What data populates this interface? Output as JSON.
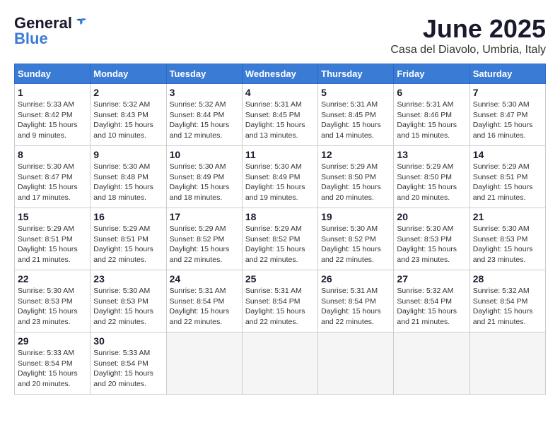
{
  "header": {
    "logo_general": "General",
    "logo_blue": "Blue",
    "month_title": "June 2025",
    "location": "Casa del Diavolo, Umbria, Italy"
  },
  "calendar": {
    "days_of_week": [
      "Sunday",
      "Monday",
      "Tuesday",
      "Wednesday",
      "Thursday",
      "Friday",
      "Saturday"
    ],
    "weeks": [
      [
        null,
        {
          "day": "2",
          "sunrise": "Sunrise: 5:32 AM",
          "sunset": "Sunset: 8:43 PM",
          "daylight": "Daylight: 15 hours and 10 minutes."
        },
        {
          "day": "3",
          "sunrise": "Sunrise: 5:32 AM",
          "sunset": "Sunset: 8:44 PM",
          "daylight": "Daylight: 15 hours and 12 minutes."
        },
        {
          "day": "4",
          "sunrise": "Sunrise: 5:31 AM",
          "sunset": "Sunset: 8:45 PM",
          "daylight": "Daylight: 15 hours and 13 minutes."
        },
        {
          "day": "5",
          "sunrise": "Sunrise: 5:31 AM",
          "sunset": "Sunset: 8:45 PM",
          "daylight": "Daylight: 15 hours and 14 minutes."
        },
        {
          "day": "6",
          "sunrise": "Sunrise: 5:31 AM",
          "sunset": "Sunset: 8:46 PM",
          "daylight": "Daylight: 15 hours and 15 minutes."
        },
        {
          "day": "7",
          "sunrise": "Sunrise: 5:30 AM",
          "sunset": "Sunset: 8:47 PM",
          "daylight": "Daylight: 15 hours and 16 minutes."
        }
      ],
      [
        {
          "day": "1",
          "sunrise": "Sunrise: 5:33 AM",
          "sunset": "Sunset: 8:42 PM",
          "daylight": "Daylight: 15 hours and 9 minutes."
        },
        {
          "day": "9",
          "sunrise": "Sunrise: 5:30 AM",
          "sunset": "Sunset: 8:48 PM",
          "daylight": "Daylight: 15 hours and 18 minutes."
        },
        {
          "day": "10",
          "sunrise": "Sunrise: 5:30 AM",
          "sunset": "Sunset: 8:49 PM",
          "daylight": "Daylight: 15 hours and 18 minutes."
        },
        {
          "day": "11",
          "sunrise": "Sunrise: 5:30 AM",
          "sunset": "Sunset: 8:49 PM",
          "daylight": "Daylight: 15 hours and 19 minutes."
        },
        {
          "day": "12",
          "sunrise": "Sunrise: 5:29 AM",
          "sunset": "Sunset: 8:50 PM",
          "daylight": "Daylight: 15 hours and 20 minutes."
        },
        {
          "day": "13",
          "sunrise": "Sunrise: 5:29 AM",
          "sunset": "Sunset: 8:50 PM",
          "daylight": "Daylight: 15 hours and 20 minutes."
        },
        {
          "day": "14",
          "sunrise": "Sunrise: 5:29 AM",
          "sunset": "Sunset: 8:51 PM",
          "daylight": "Daylight: 15 hours and 21 minutes."
        }
      ],
      [
        {
          "day": "8",
          "sunrise": "Sunrise: 5:30 AM",
          "sunset": "Sunset: 8:47 PM",
          "daylight": "Daylight: 15 hours and 17 minutes."
        },
        {
          "day": "16",
          "sunrise": "Sunrise: 5:29 AM",
          "sunset": "Sunset: 8:51 PM",
          "daylight": "Daylight: 15 hours and 22 minutes."
        },
        {
          "day": "17",
          "sunrise": "Sunrise: 5:29 AM",
          "sunset": "Sunset: 8:52 PM",
          "daylight": "Daylight: 15 hours and 22 minutes."
        },
        {
          "day": "18",
          "sunrise": "Sunrise: 5:29 AM",
          "sunset": "Sunset: 8:52 PM",
          "daylight": "Daylight: 15 hours and 22 minutes."
        },
        {
          "day": "19",
          "sunrise": "Sunrise: 5:30 AM",
          "sunset": "Sunset: 8:52 PM",
          "daylight": "Daylight: 15 hours and 22 minutes."
        },
        {
          "day": "20",
          "sunrise": "Sunrise: 5:30 AM",
          "sunset": "Sunset: 8:53 PM",
          "daylight": "Daylight: 15 hours and 23 minutes."
        },
        {
          "day": "21",
          "sunrise": "Sunrise: 5:30 AM",
          "sunset": "Sunset: 8:53 PM",
          "daylight": "Daylight: 15 hours and 23 minutes."
        }
      ],
      [
        {
          "day": "15",
          "sunrise": "Sunrise: 5:29 AM",
          "sunset": "Sunset: 8:51 PM",
          "daylight": "Daylight: 15 hours and 21 minutes."
        },
        {
          "day": "23",
          "sunrise": "Sunrise: 5:30 AM",
          "sunset": "Sunset: 8:53 PM",
          "daylight": "Daylight: 15 hours and 22 minutes."
        },
        {
          "day": "24",
          "sunrise": "Sunrise: 5:31 AM",
          "sunset": "Sunset: 8:54 PM",
          "daylight": "Daylight: 15 hours and 22 minutes."
        },
        {
          "day": "25",
          "sunrise": "Sunrise: 5:31 AM",
          "sunset": "Sunset: 8:54 PM",
          "daylight": "Daylight: 15 hours and 22 minutes."
        },
        {
          "day": "26",
          "sunrise": "Sunrise: 5:31 AM",
          "sunset": "Sunset: 8:54 PM",
          "daylight": "Daylight: 15 hours and 22 minutes."
        },
        {
          "day": "27",
          "sunrise": "Sunrise: 5:32 AM",
          "sunset": "Sunset: 8:54 PM",
          "daylight": "Daylight: 15 hours and 21 minutes."
        },
        {
          "day": "28",
          "sunrise": "Sunrise: 5:32 AM",
          "sunset": "Sunset: 8:54 PM",
          "daylight": "Daylight: 15 hours and 21 minutes."
        }
      ],
      [
        {
          "day": "22",
          "sunrise": "Sunrise: 5:30 AM",
          "sunset": "Sunset: 8:53 PM",
          "daylight": "Daylight: 15 hours and 23 minutes."
        },
        {
          "day": "30",
          "sunrise": "Sunrise: 5:33 AM",
          "sunset": "Sunset: 8:54 PM",
          "daylight": "Daylight: 15 hours and 20 minutes."
        },
        null,
        null,
        null,
        null,
        null
      ],
      [
        {
          "day": "29",
          "sunrise": "Sunrise: 5:33 AM",
          "sunset": "Sunset: 8:54 PM",
          "daylight": "Daylight: 15 hours and 20 minutes."
        },
        null,
        null,
        null,
        null,
        null,
        null
      ]
    ]
  }
}
